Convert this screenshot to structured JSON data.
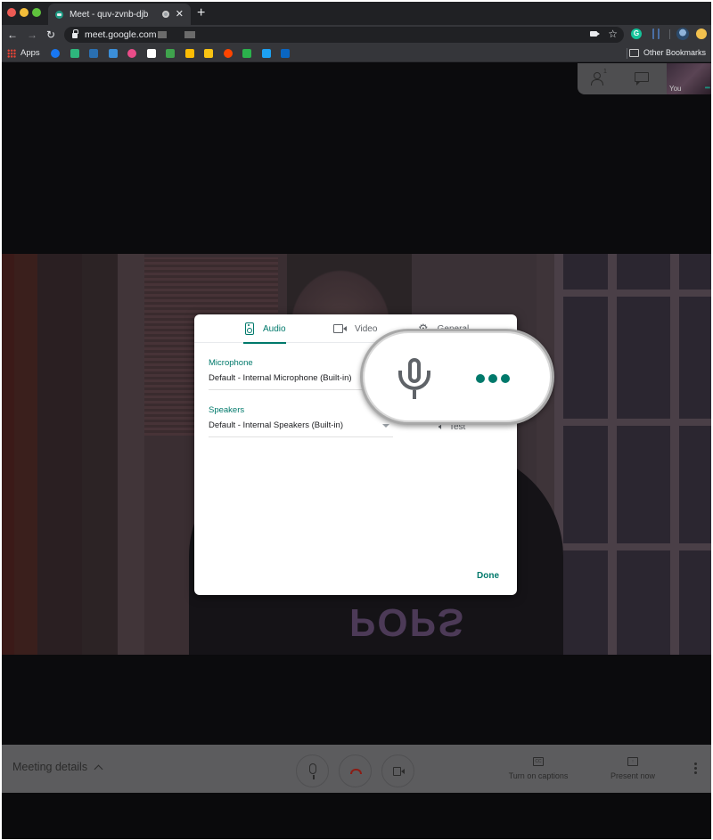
{
  "browser": {
    "tab_title": "Meet - quv-zvnb-djb",
    "new_tab_icon": "+",
    "url": "meet.google.com",
    "bookmarks_apps_label": "Apps",
    "bookmarks": [
      {
        "name": "messenger",
        "color": "#1877f2"
      },
      {
        "name": "slack",
        "color": "#2eb67d"
      },
      {
        "name": "amazon",
        "color": "#2a6fb0"
      },
      {
        "name": "calendar",
        "color": "#3b8ed8"
      },
      {
        "name": "dribbble",
        "color": "#ea4c89"
      },
      {
        "name": "notion",
        "color": "#ffffff"
      },
      {
        "name": "evernote",
        "color": "#3fa34d"
      },
      {
        "name": "google-drive",
        "color": "#fbbc04"
      },
      {
        "name": "google-keep",
        "color": "#f9c413"
      },
      {
        "name": "reddit",
        "color": "#ff4500"
      },
      {
        "name": "feedly",
        "color": "#2bb24c"
      },
      {
        "name": "twitter",
        "color": "#1da1f2"
      },
      {
        "name": "linkedin",
        "color": "#0a66c2"
      }
    ],
    "other_bookmarks_label": "Other Bookmarks",
    "extension_grammarly_letter": "G"
  },
  "meet": {
    "participants_count": "1",
    "self_tile_label": "You",
    "self_tile_more": "•••",
    "video_shirt_text": "POPS",
    "settings_dialog": {
      "tabs": [
        {
          "label": "Audio",
          "active": true
        },
        {
          "label": "Video",
          "active": false
        },
        {
          "label": "General",
          "active": false
        }
      ],
      "microphone_label": "Microphone",
      "microphone_value": "Default - Internal Microphone (Built-in)",
      "speakers_label": "Speakers",
      "speakers_value": "Default - Internal Speakers (Built-in)",
      "test_label": "Test",
      "done_label": "Done",
      "accent_color": "#00796b"
    },
    "bottom_bar": {
      "meeting_details_label": "Meeting details",
      "captions_label": "Turn on captions",
      "captions_icon": "CC",
      "present_label": "Present now",
      "present_icon": "↑"
    }
  }
}
